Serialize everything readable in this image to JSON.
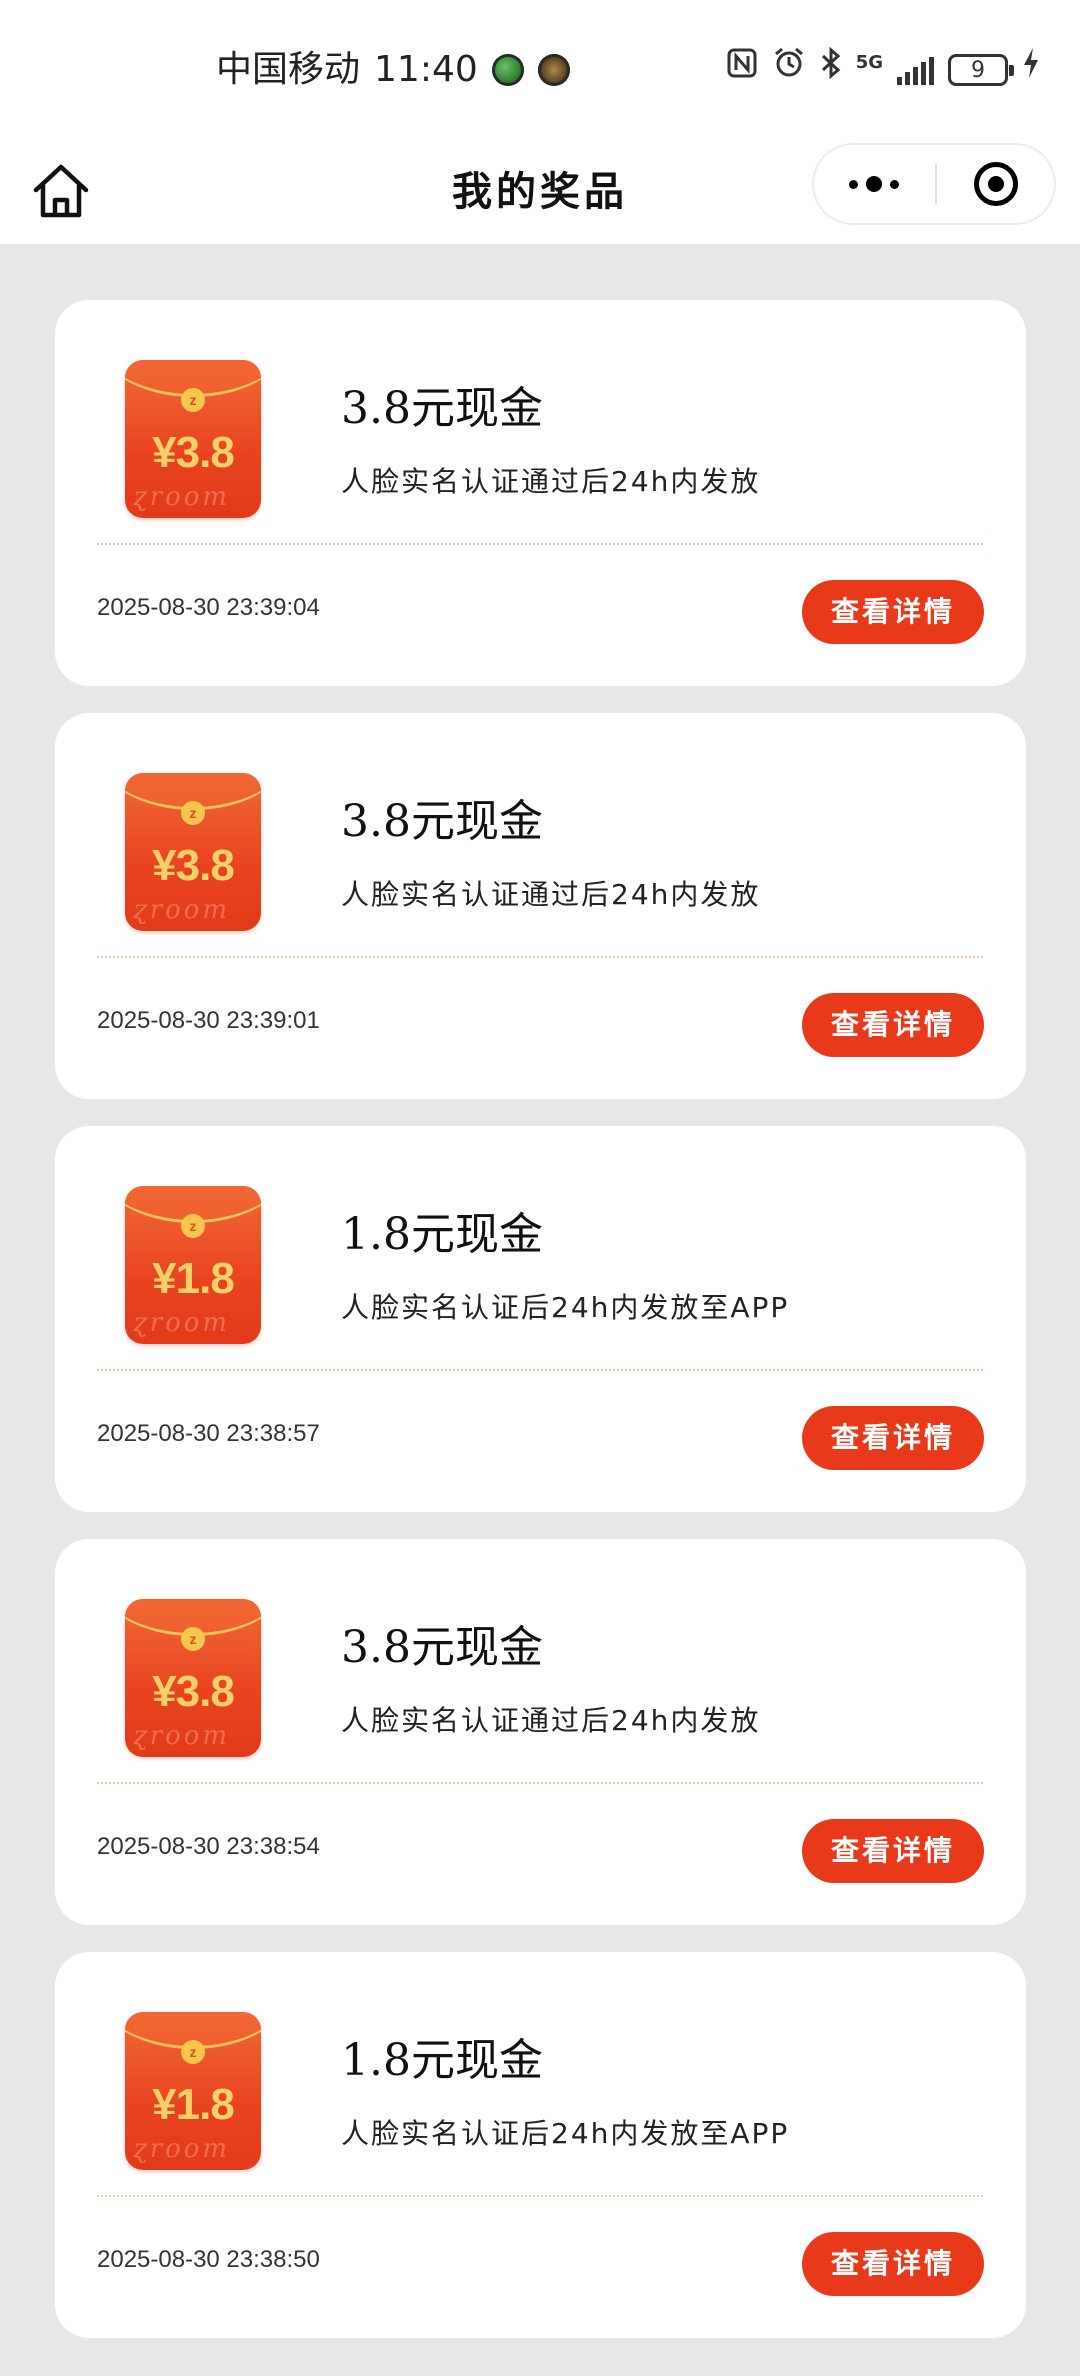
{
  "status_bar": {
    "carrier": "中国移动",
    "time": "11:40",
    "network": "5G",
    "battery": "9"
  },
  "header": {
    "title": "我的奖品"
  },
  "prizes": [
    {
      "envelope_amount": "¥3.8",
      "name": "3.8元现金",
      "desc": "人脸实名认证通过后24h内发放",
      "time": "2025-08-30 23:39:04",
      "button": "查看详情"
    },
    {
      "envelope_amount": "¥3.8",
      "name": "3.8元现金",
      "desc": "人脸实名认证通过后24h内发放",
      "time": "2025-08-30 23:39:01",
      "button": "查看详情"
    },
    {
      "envelope_amount": "¥1.8",
      "name": "1.8元现金",
      "desc": "人脸实名认证后24h内发放至APP",
      "time": "2025-08-30 23:38:57",
      "button": "查看详情"
    },
    {
      "envelope_amount": "¥3.8",
      "name": "3.8元现金",
      "desc": "人脸实名认证通过后24h内发放",
      "time": "2025-08-30 23:38:54",
      "button": "查看详情"
    },
    {
      "envelope_amount": "¥1.8",
      "name": "1.8元现金",
      "desc": "人脸实名认证后24h内发放至APP",
      "time": "2025-08-30 23:38:50",
      "button": "查看详情"
    }
  ],
  "colors": {
    "accent": "#e8391b",
    "background": "#e7e7e7",
    "card": "#ffffff"
  },
  "icons": [
    "home-icon",
    "more-icon",
    "close-icon",
    "nfc-icon",
    "alarm-icon",
    "bluetooth-icon",
    "signal-icon",
    "battery-icon",
    "charging-icon"
  ]
}
